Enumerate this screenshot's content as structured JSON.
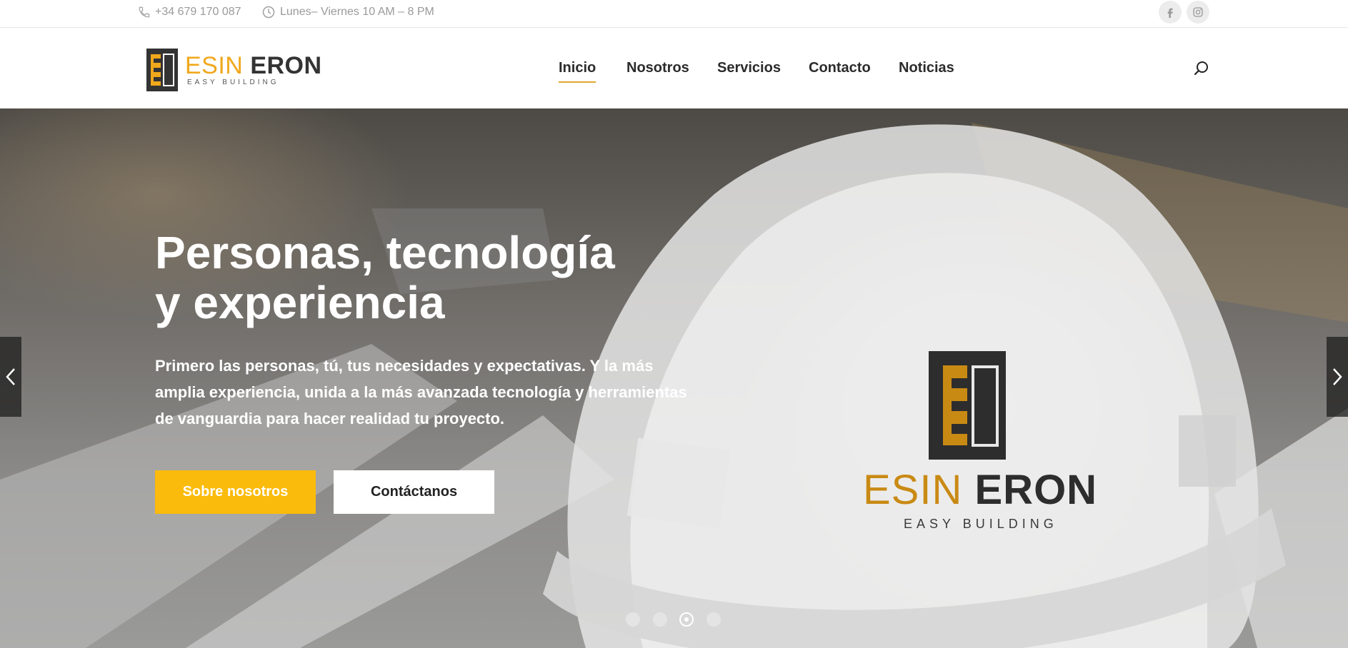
{
  "topbar": {
    "phone": "+34 679 170 087",
    "hours": "Lunes– Viernes 10 AM – 8 PM",
    "phone_icon": "phone-icon",
    "clock_icon": "clock-icon",
    "social": [
      {
        "name": "facebook",
        "glyph": "f"
      },
      {
        "name": "instagram",
        "glyph": ""
      }
    ]
  },
  "brand": {
    "name_part1": "ESIN",
    "name_part2": "ERON",
    "tagline": "EASY BUILDING",
    "accent_color": "#f0a81c"
  },
  "nav": {
    "items": [
      {
        "label": "Inicio",
        "active": true
      },
      {
        "label": "Nosotros",
        "active": false
      },
      {
        "label": "Servicios",
        "active": false
      },
      {
        "label": "Contacto",
        "active": false
      },
      {
        "label": "Noticias",
        "active": false
      }
    ],
    "search_icon": "search-icon"
  },
  "hero": {
    "title_line1": "Personas, tecnología",
    "title_line2": "y experiencia",
    "description": "Primero las personas, tú, tus necesidades y expectativas. Y la más amplia experiencia, unida a la más avanzada tecnología y herramientas de vanguardia para hacer realidad tu proyecto.",
    "primary_button": "Sobre nosotros",
    "secondary_button": "Contáctanos",
    "primary_color": "#fbbb0c",
    "helmet_brand_part1": "ESIN",
    "helmet_brand_part2": "ERON",
    "helmet_tagline": "EASY BUILDING",
    "slides_total": 4,
    "active_slide": 3
  }
}
